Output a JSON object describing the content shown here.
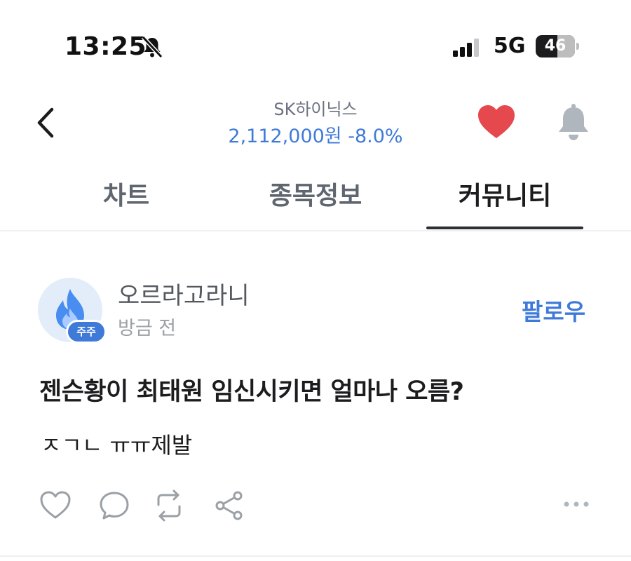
{
  "status_bar": {
    "time": "13:25",
    "network": "5G",
    "battery": "46"
  },
  "header": {
    "stock_name": "SK하이닉스",
    "price": "2,112,000원",
    "change": "-8.0%"
  },
  "tabs": [
    {
      "label": "차트",
      "active": false
    },
    {
      "label": "종목정보",
      "active": false
    },
    {
      "label": "커뮤니티",
      "active": true
    }
  ],
  "post": {
    "author": "오르라고라니",
    "badge": "주주",
    "time": "방금 전",
    "follow_label": "팔로우",
    "title": "젠슨황이 최태원 임신시키면 얼마나 오름?",
    "body": "ㅈㄱㄴ ㅠㅠ제발"
  },
  "colors": {
    "accent": "#3f7ad8",
    "heart": "#e5484d",
    "bell": "#b0b6bd"
  },
  "icons": [
    "bell-slash-icon",
    "cellular-signal-icon",
    "chevron-left-icon",
    "heart-icon",
    "bell-icon",
    "flame-icon",
    "heart-outline-icon",
    "comment-icon",
    "repost-icon",
    "share-icon",
    "more-icon"
  ]
}
